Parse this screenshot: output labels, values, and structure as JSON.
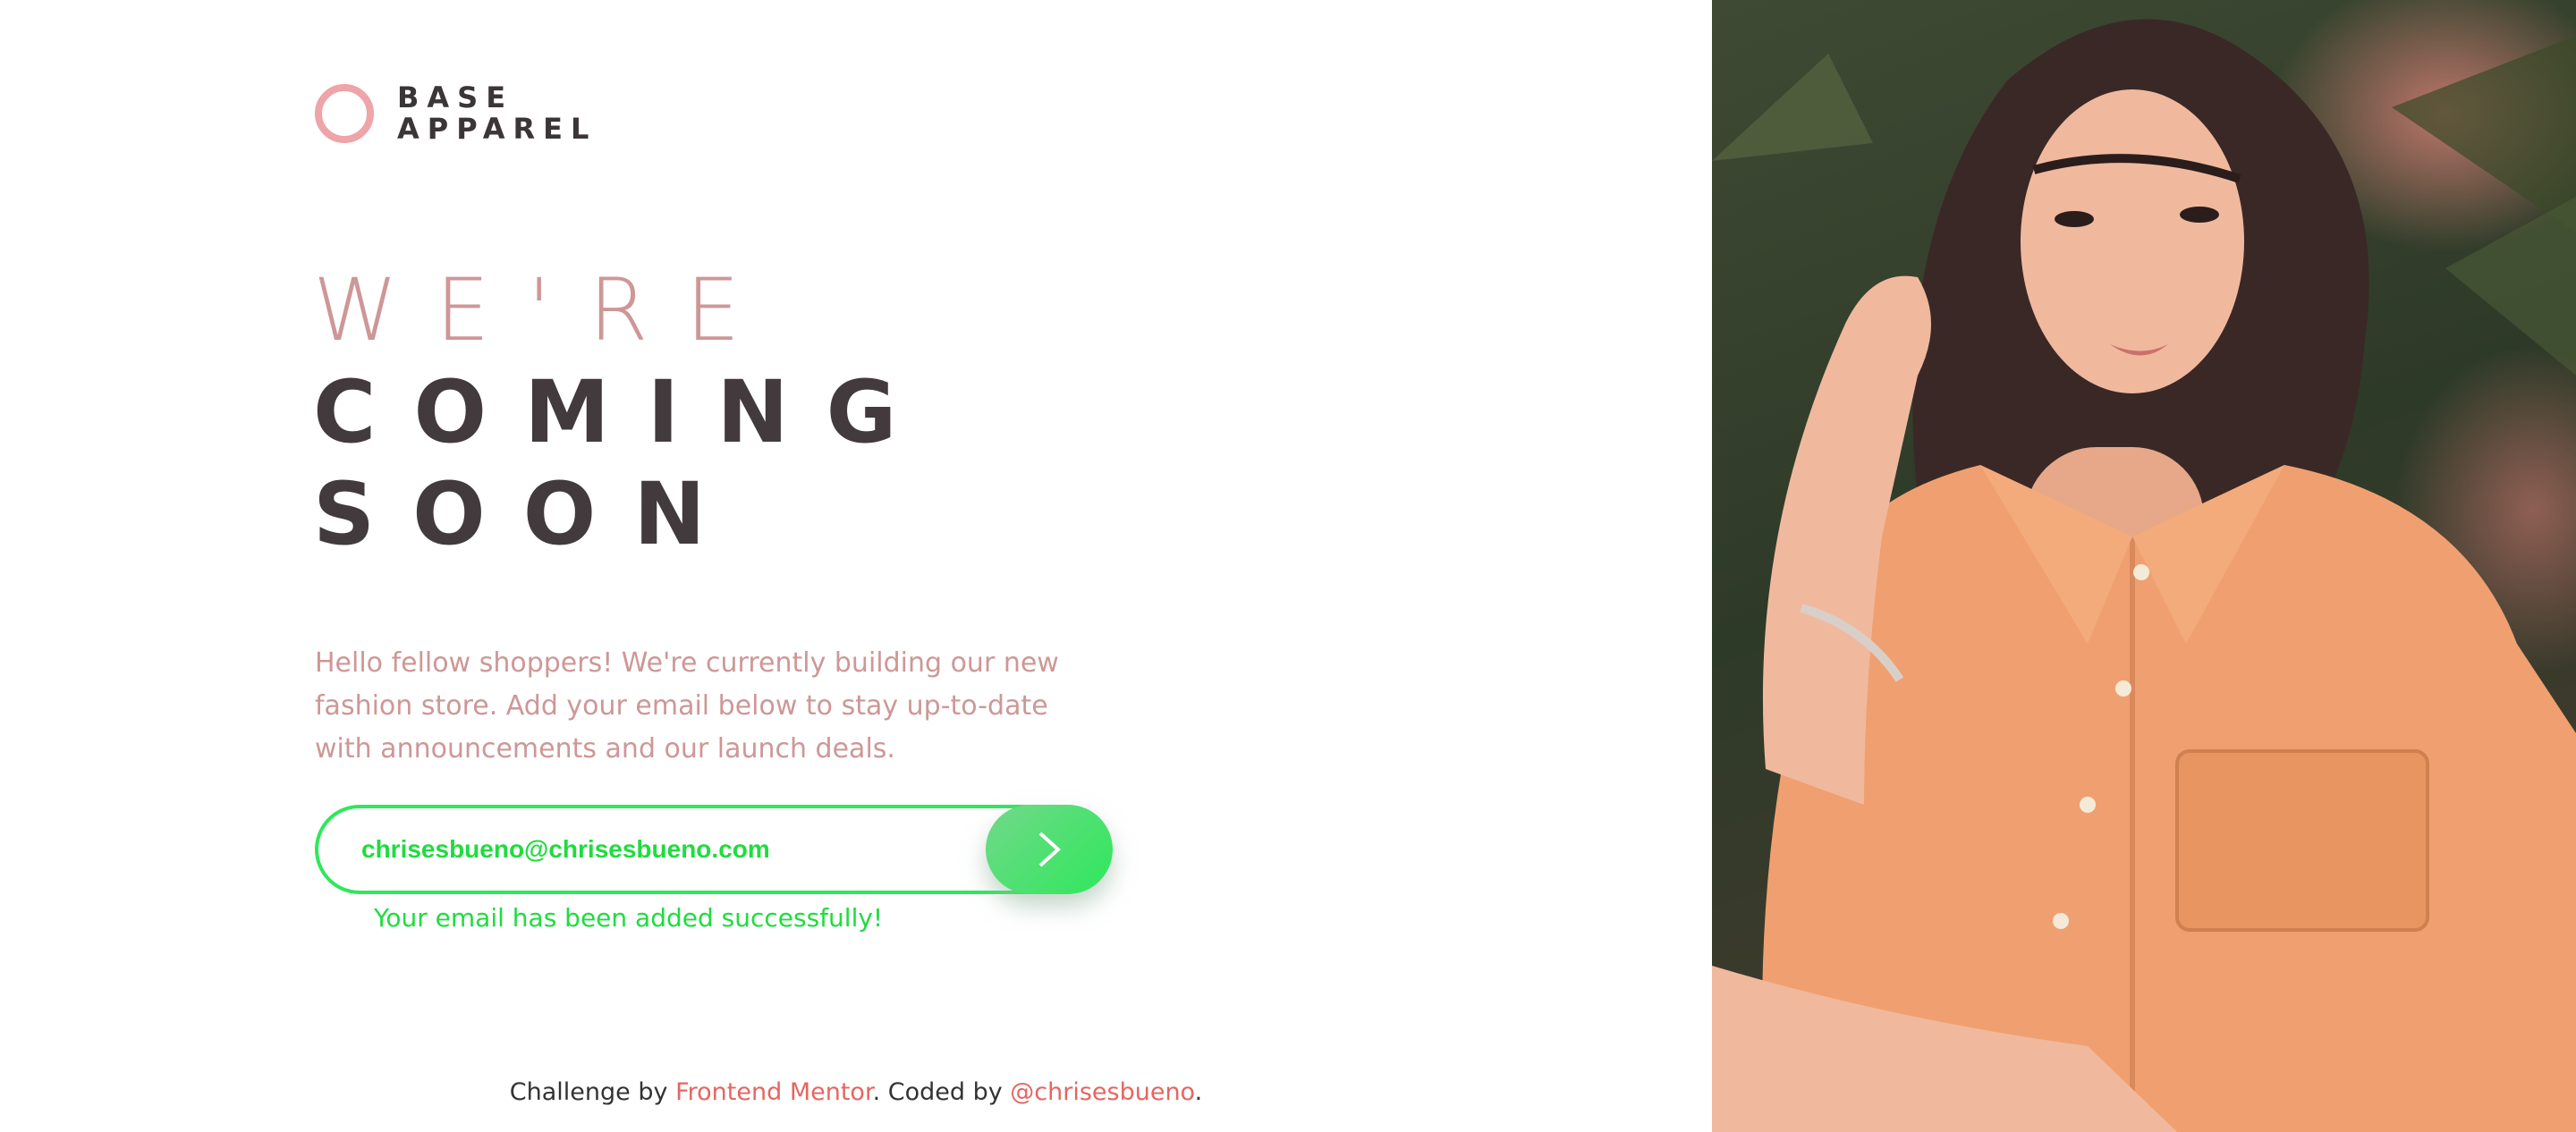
{
  "brand": {
    "line1": "BASE",
    "line2": "APPAREL"
  },
  "hero": {
    "line1": "WE'RE",
    "line2": "COMING",
    "line3": "SOON"
  },
  "lead": "Hello fellow shoppers! We're currently building our new fashion store. Add your email below to stay up-to-date with announcements and our launch deals.",
  "form": {
    "email_value": "chrisesbueno@chrisesbueno.com",
    "submit_icon": "chevron-right-icon",
    "success": "Your email has been added successfully!"
  },
  "footer": {
    "prefix": "Challenge by ",
    "link1": "Frontend Mentor",
    "middle": ". Coded by ",
    "link2": "@chrisesbueno",
    "suffix": "."
  },
  "colors": {
    "accent_pink": "#ce9797",
    "dark": "#423a3d",
    "success_green": "#2ee85b",
    "link_red": "#e46662"
  }
}
